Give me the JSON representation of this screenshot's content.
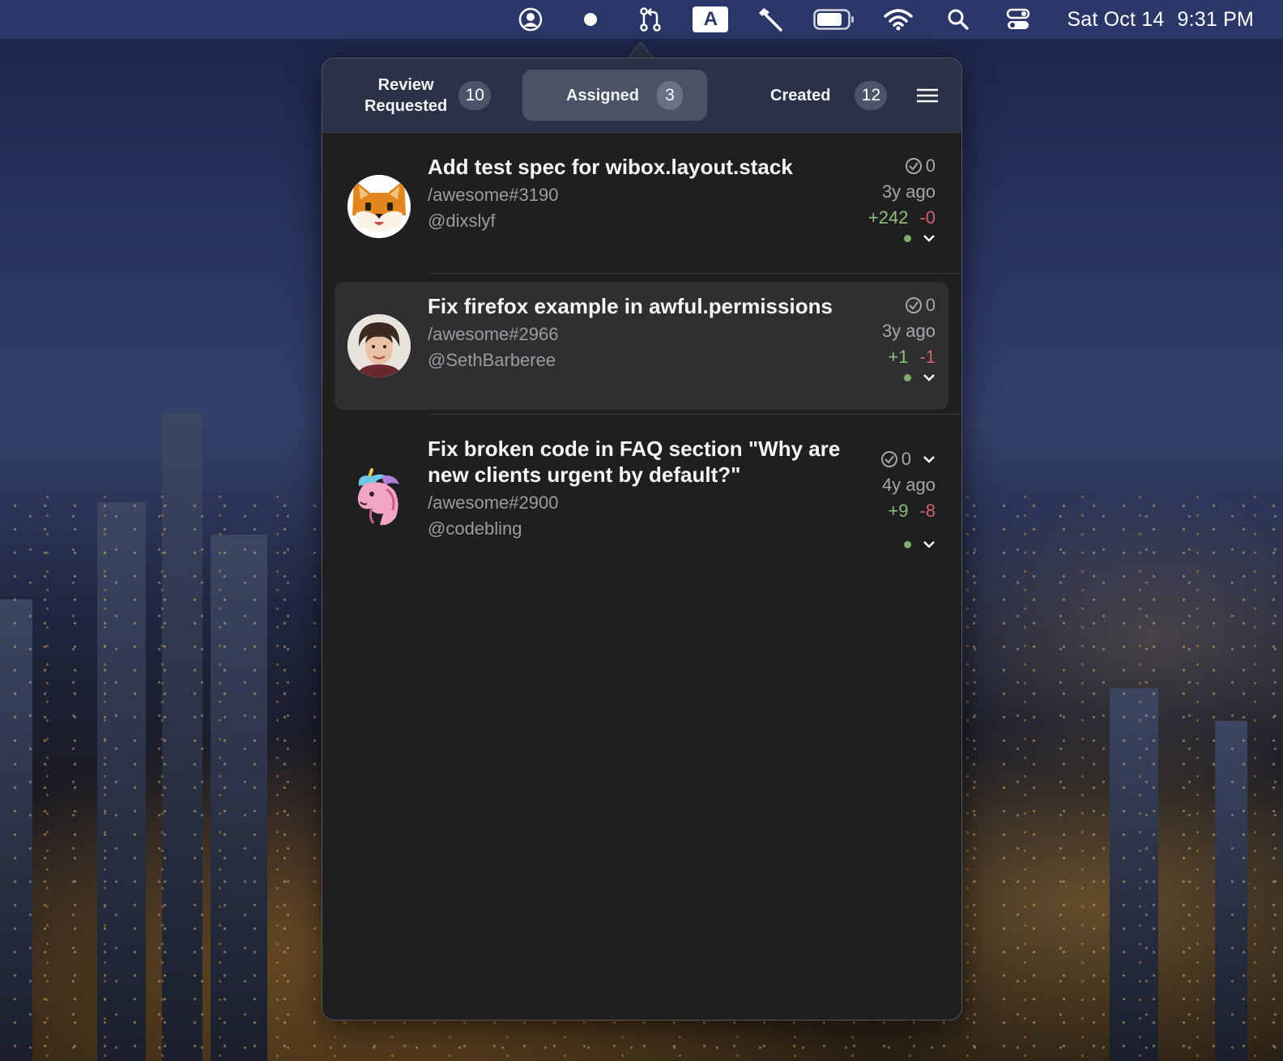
{
  "menubar": {
    "icons": [
      "person-circle-icon",
      "record-dot-icon",
      "pull-request-icon",
      "input-source-icon",
      "hammer-icon",
      "battery-icon",
      "wifi-icon",
      "spotlight-search-icon",
      "control-center-icon"
    ],
    "input_source_label": "A",
    "clock": {
      "date": "Sat Oct 14",
      "time": "9:31 PM"
    }
  },
  "tabs": [
    {
      "label_line1": "Review",
      "label_line2": "Requested",
      "count": "10",
      "active": false
    },
    {
      "label": "Assigned",
      "count": "3",
      "active": true
    },
    {
      "label": "Created",
      "count": "12",
      "active": false
    }
  ],
  "pull_requests": [
    {
      "title": "Add test spec for wibox.layout.stack",
      "ref": "/awesome#3190",
      "author": "@dixslyf",
      "checks": "0",
      "age": "3y ago",
      "additions": "+242",
      "deletions": "-0",
      "avatar_icon": "shiba-dog-avatar"
    },
    {
      "title": "Fix firefox example in awful.permissions",
      "ref": "/awesome#2966",
      "author": "@SethBarberee",
      "checks": "0",
      "age": "3y ago",
      "additions": "+1",
      "deletions": "-1",
      "avatar_icon": "person-photo-avatar"
    },
    {
      "title_line1": "Fix broken code in FAQ section \"Why are",
      "title_line2": "new clients urgent by default?\"",
      "ref": "/awesome#2900",
      "author": "@codebling",
      "checks": "0",
      "age": "4y ago",
      "additions": "+9",
      "deletions": "-8",
      "avatar_icon": "unicorn-avatar"
    }
  ],
  "colors": {
    "menubar": "#2a3768",
    "popover_bg": "#1f1f21",
    "tabbar_bg": "#2b3247",
    "additions": "#8fbf7a",
    "deletions": "#d1636a",
    "status_dot": "#7fae6c"
  }
}
